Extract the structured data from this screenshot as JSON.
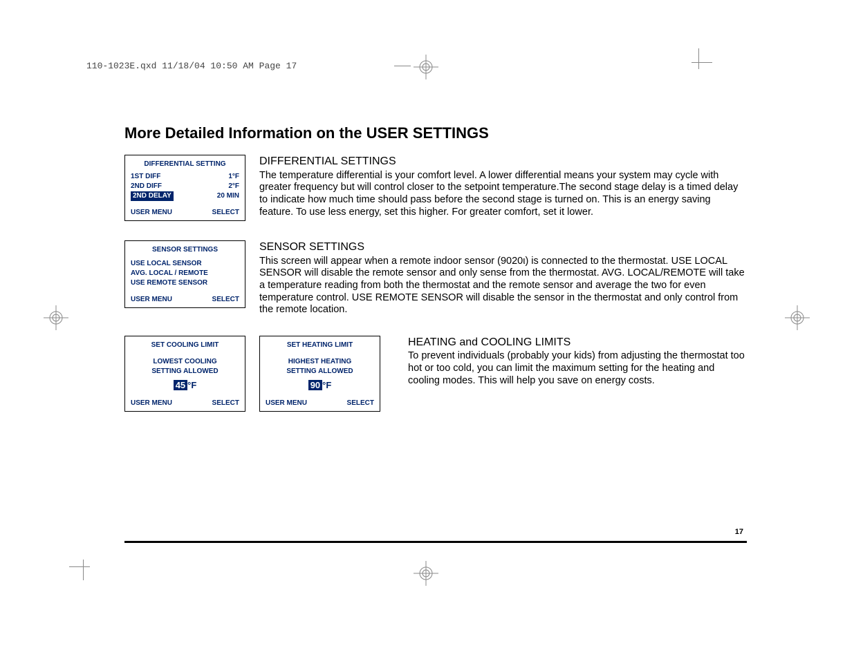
{
  "print_header": "110-1023E.qxd  11/18/04  10:50 AM  Page 17",
  "page_title": "More Detailed Information on the USER SETTINGS",
  "page_number": "17",
  "panel_footer": {
    "left": "USER MENU",
    "right": "SELECT"
  },
  "section1": {
    "panel_title": "DIFFERENTIAL SETTING",
    "rows": [
      {
        "label": "1ST DIFF",
        "value": "1°F",
        "highlight": false
      },
      {
        "label": "2ND DIFF",
        "value": "2°F",
        "highlight": false
      },
      {
        "label": "2ND DELAY",
        "value": "20 MIN",
        "highlight": true
      }
    ],
    "heading": "DIFFERENTIAL SETTINGS",
    "body": "The temperature differential is your comfort level. A lower differential means your system may cycle with greater frequency but will control closer to the setpoint temperature.The second stage delay is a timed delay to indicate how much time should pass before the second stage is turned on. This is an energy saving feature. To use less energy, set this higher. For greater comfort, set it lower."
  },
  "section2": {
    "panel_title": "SENSOR SETTINGS",
    "options": [
      "USE LOCAL SENSOR",
      "AVG. LOCAL / REMOTE",
      "USE REMOTE SENSOR"
    ],
    "heading": "SENSOR SETTINGS",
    "body": "This screen will appear when a remote indoor sensor (9020ι) is connected to the thermostat. USE LOCAL SENSOR will disable the remote sensor and only sense from the thermostat. AVG. LOCAL/REMOTE will take a temperature reading from both the thermostat and the remote sensor and average the two for even temperature control. USE REMOTE SENSOR will disable the sensor in the thermostat and only control from the remote location."
  },
  "section3": {
    "cool": {
      "title": "SET COOLING LIMIT",
      "line1": "LOWEST COOLING",
      "line2": "SETTING ALLOWED",
      "value": "45",
      "unit": "°F"
    },
    "heat": {
      "title": "SET HEATING LIMIT",
      "line1": "HIGHEST HEATING",
      "line2": "SETTING ALLOWED",
      "value": "90",
      "unit": "°F"
    },
    "heading": "HEATING and COOLING LIMITS",
    "body": "To prevent individuals (probably your kids) from adjusting the thermostat too hot or too cold, you can limit the maximum setting for the heating and cooling modes. This will help you save on energy costs."
  }
}
